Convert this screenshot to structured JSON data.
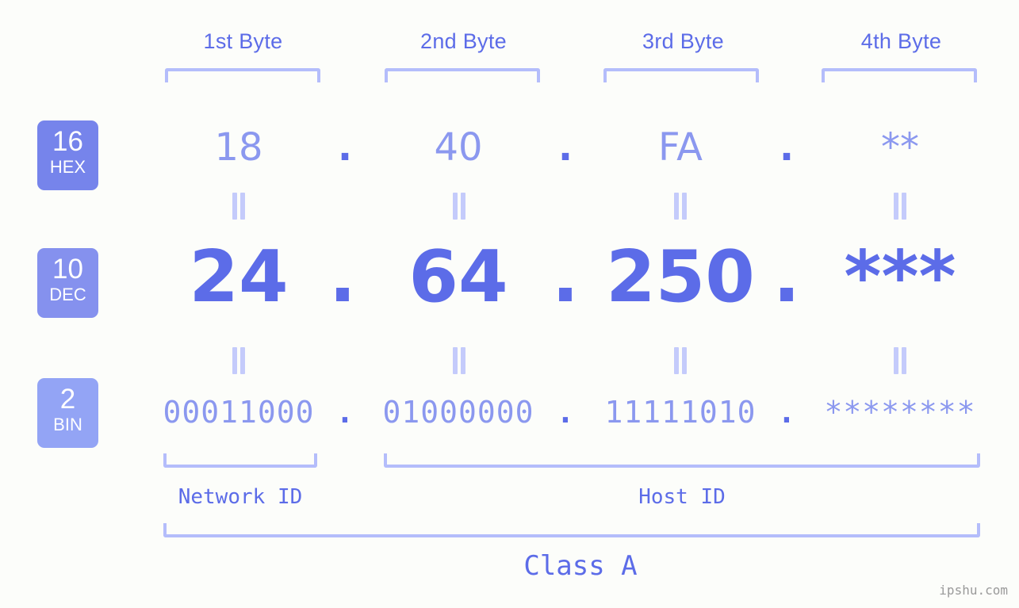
{
  "background_color": "#fcfdfa",
  "accent_color": "#5c6ce8",
  "accent_light": "#8b98ef",
  "bracket_color": "#b4bdfb",
  "byte_headers": [
    {
      "label": "1st Byte"
    },
    {
      "label": "2nd Byte"
    },
    {
      "label": "3rd Byte"
    },
    {
      "label": "4th Byte"
    }
  ],
  "rows": {
    "hex": {
      "badge_number": "16",
      "badge_name": "HEX",
      "badge_color": "#7684eb",
      "values": [
        "18",
        "40",
        "FA",
        "**"
      ]
    },
    "dec": {
      "badge_number": "10",
      "badge_name": "DEC",
      "badge_color": "#8591ee",
      "values": [
        "24",
        "64",
        "250",
        "***"
      ]
    },
    "bin": {
      "badge_number": "2",
      "badge_name": "BIN",
      "badge_color": "#93a4f5",
      "values": [
        "00011000",
        "01000000",
        "11111010",
        "********"
      ]
    }
  },
  "separator": ".",
  "equals_glyph": "=",
  "footer": {
    "network_id_label": "Network ID",
    "host_id_label": "Host ID",
    "class_label": "Class A"
  },
  "watermark": "ipshu.com"
}
